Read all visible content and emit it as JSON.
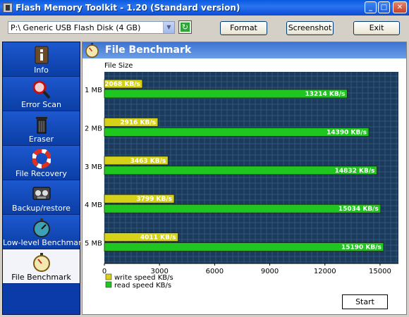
{
  "window": {
    "title": "Flash Memory Toolkit - 1.20 (Standard version)",
    "controls": {
      "minimize": "_",
      "maximize": "□",
      "close": "✕"
    }
  },
  "toolbar": {
    "drive_value": "P:\\ Generic USB Flash Disk (4 GB)",
    "format_label": "Format",
    "screenshot_label": "Screenshot",
    "exit_label": "Exit"
  },
  "sidebar": {
    "items": [
      {
        "label": "Info",
        "icon": "info-icon"
      },
      {
        "label": "Error Scan",
        "icon": "magnifier-icon"
      },
      {
        "label": "Eraser",
        "icon": "trash-icon"
      },
      {
        "label": "File Recovery",
        "icon": "lifebuoy-icon"
      },
      {
        "label": "Backup/restore",
        "icon": "tape-icon"
      },
      {
        "label": "Low-level Benchmark",
        "icon": "stopwatch-icon"
      },
      {
        "label": "File Benchmark",
        "icon": "stopwatch-icon",
        "active": true
      }
    ]
  },
  "main": {
    "title": "File Benchmark",
    "start_label": "Start"
  },
  "chart_data": {
    "type": "bar",
    "orientation": "horizontal",
    "ylabel": "File Size",
    "categories": [
      "1 MB",
      "2 MB",
      "3 MB",
      "4 MB",
      "5 MB"
    ],
    "series": [
      {
        "name": "write speed KB/s",
        "color": "#d6d21a",
        "values": [
          2068,
          2916,
          3463,
          3799,
          4011
        ],
        "labels": [
          "2068 KB/s",
          "2916 KB/s",
          "3463 KB/s",
          "3799 KB/s",
          "4011 KB/s"
        ]
      },
      {
        "name": "read speed KB/s",
        "color": "#1fc61f",
        "values": [
          13214,
          14390,
          14832,
          15034,
          15190
        ],
        "labels": [
          "13214 KB/s",
          "14390 KB/s",
          "14832 KB/s",
          "15034 KB/s",
          "15190 KB/s"
        ]
      }
    ],
    "xlim": [
      0,
      16000
    ],
    "xticks": [
      0,
      3000,
      6000,
      9000,
      12000,
      15000
    ],
    "legend_position": "bottom-left",
    "grid": true,
    "background": "#1b3a5c"
  }
}
